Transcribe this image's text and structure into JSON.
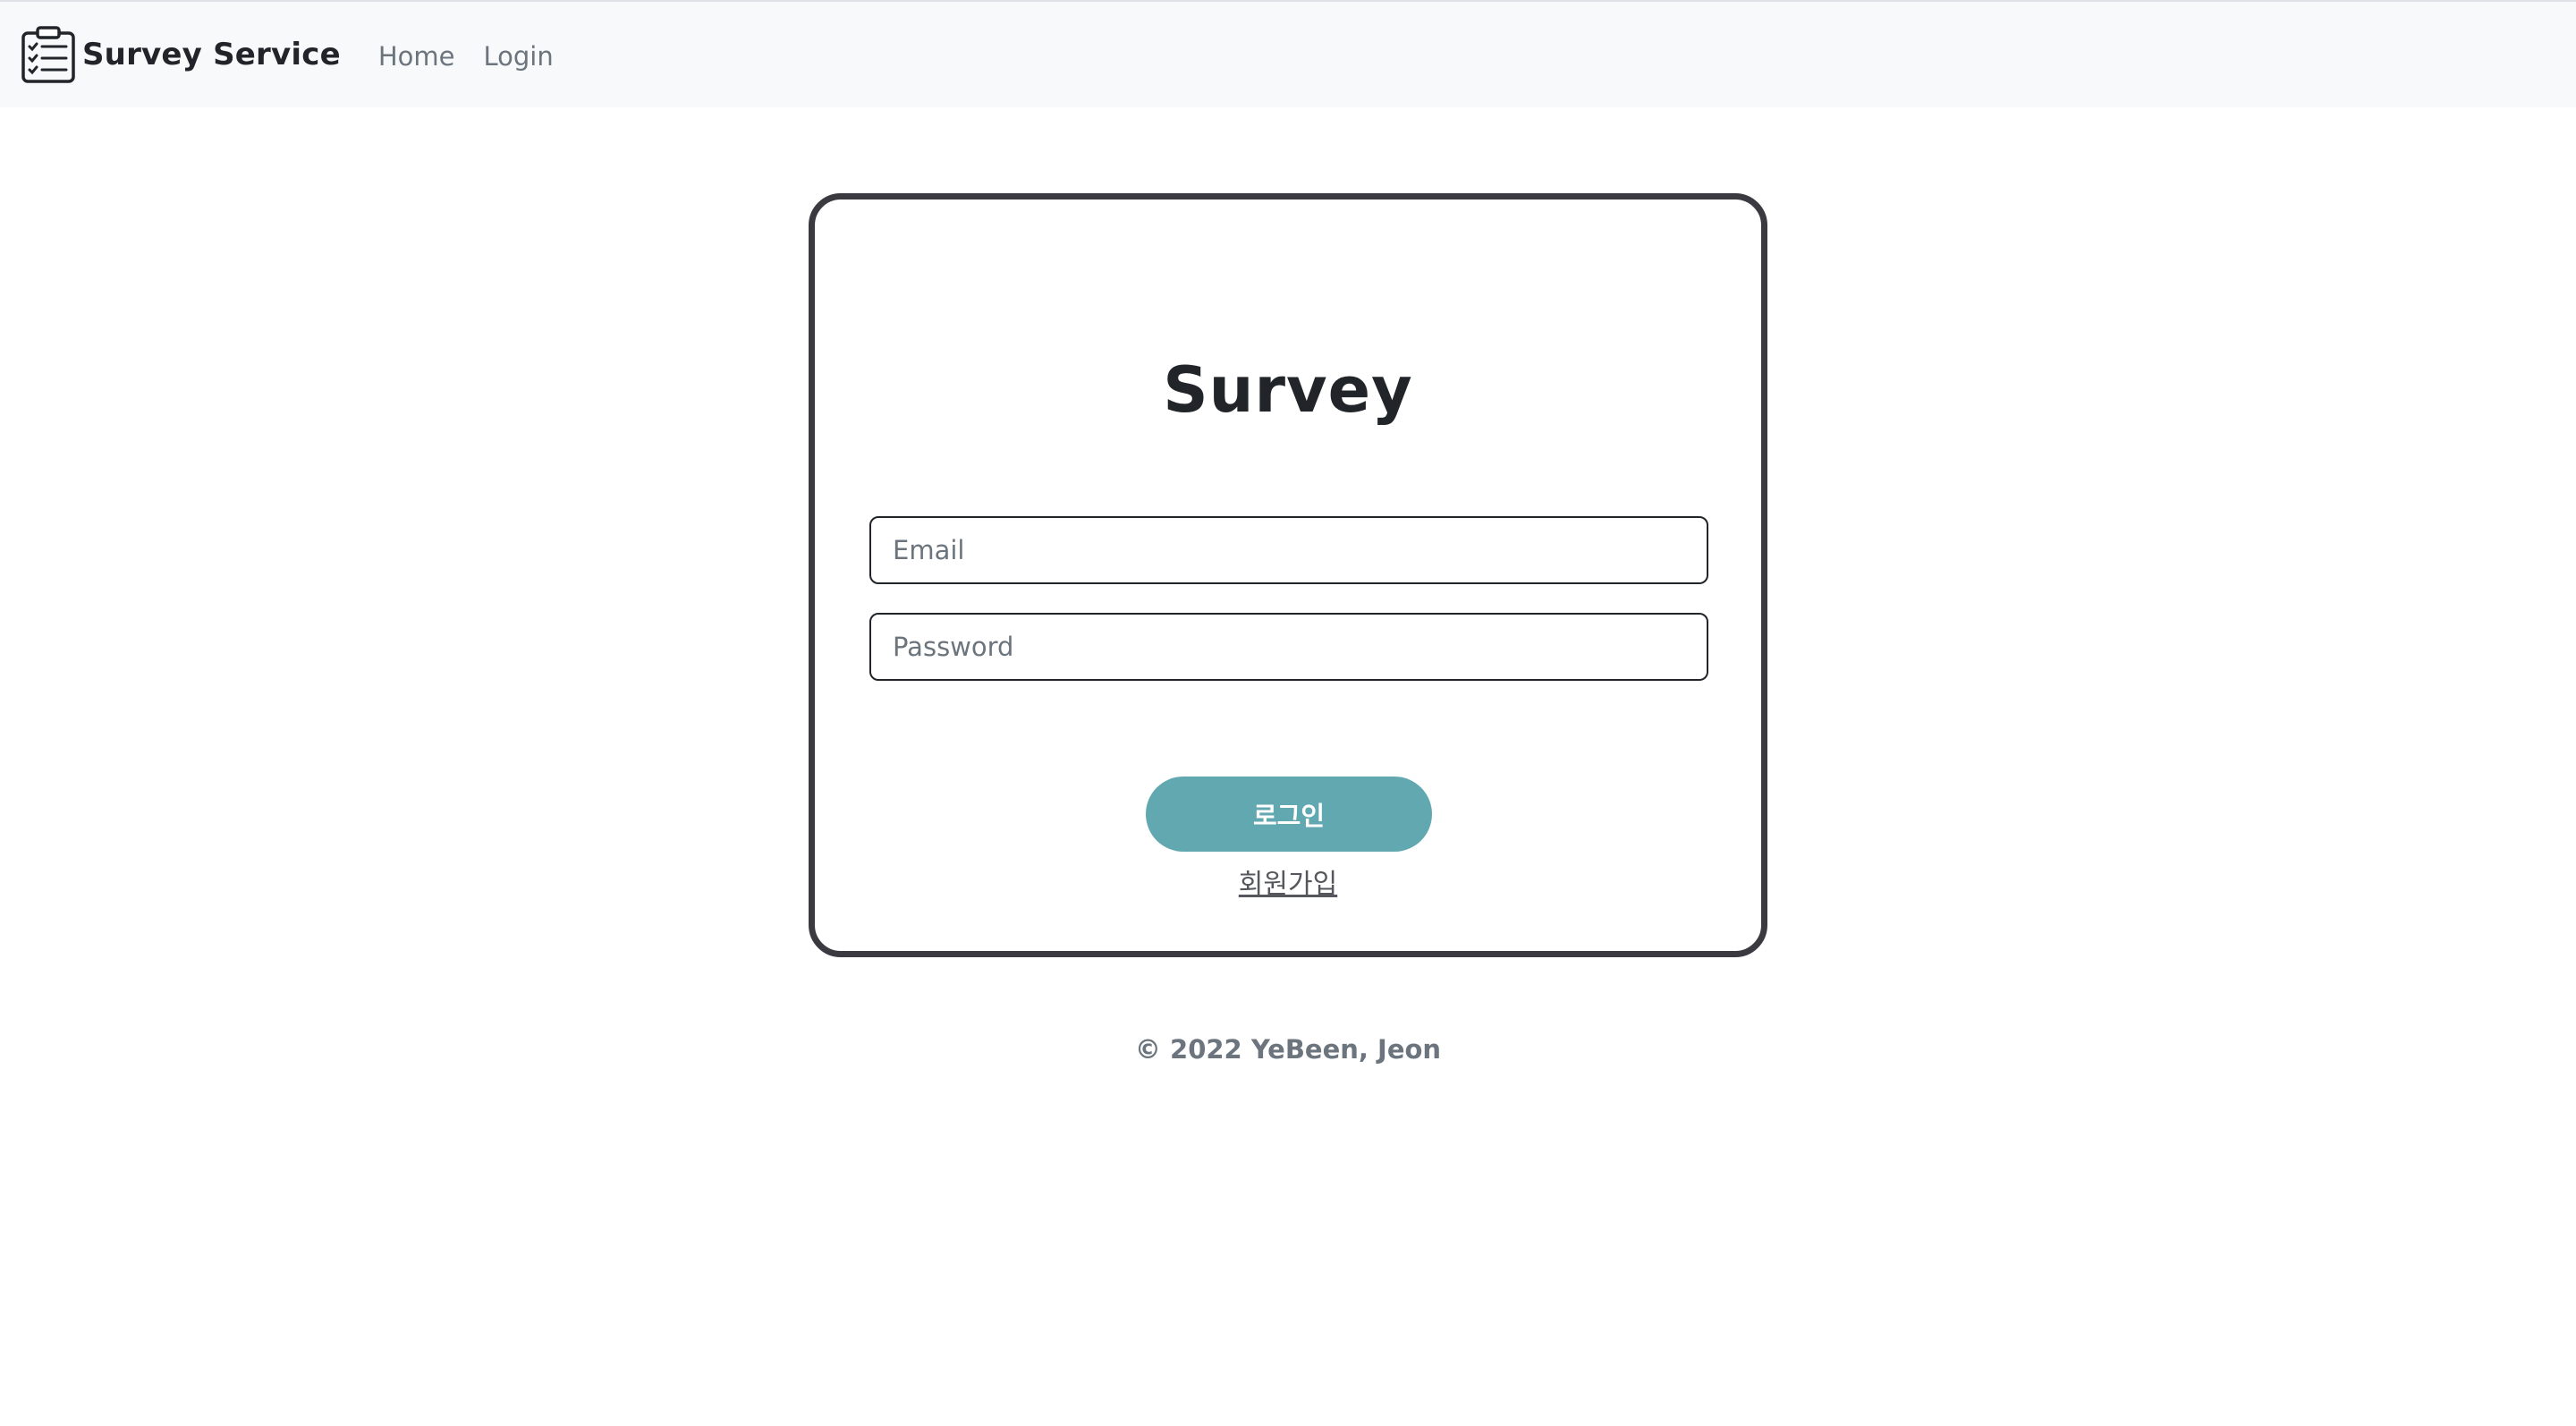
{
  "navbar": {
    "brand": "Survey Service",
    "brand_icon": "clipboard-checklist-icon",
    "links": [
      "Home",
      "Login"
    ]
  },
  "login_card": {
    "title": "Survey",
    "email_placeholder": "Email",
    "password_placeholder": "Password",
    "login_button": "로그인",
    "signup_link": "회원가입"
  },
  "footer": {
    "copyright": "© 2022 YeBeen, Jeon"
  },
  "colors": {
    "navbar_bg": "#f8f9fa",
    "card_border": "#3b3a40",
    "login_button": "#62a8b0",
    "muted_text": "#6c757d"
  }
}
